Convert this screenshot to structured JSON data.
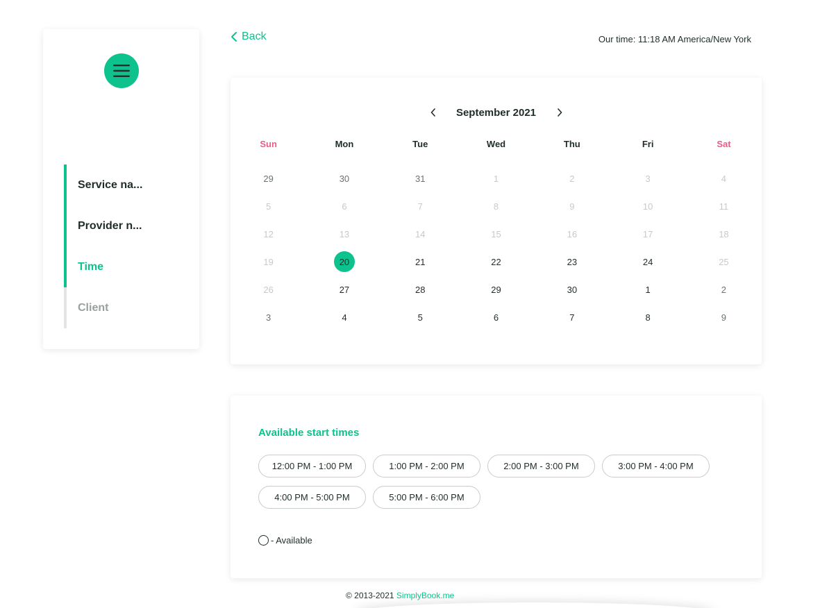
{
  "sidebar": {
    "menu_icon": "hamburger-menu-icon",
    "steps": [
      {
        "label": "Service na...",
        "state": "done"
      },
      {
        "label": "Provider n...",
        "state": "done"
      },
      {
        "label": "Time",
        "state": "active"
      },
      {
        "label": "Client",
        "state": "pending"
      }
    ]
  },
  "topbar": {
    "back_label": "Back",
    "our_time": "Our time: 11:18 AM America/New York"
  },
  "calendar": {
    "month_label": "September 2021",
    "weekdays": [
      "Sun",
      "Mon",
      "Tue",
      "Wed",
      "Thu",
      "Fri",
      "Sat"
    ],
    "weeks": [
      [
        {
          "d": "29",
          "s": "prev"
        },
        {
          "d": "30",
          "s": "prev"
        },
        {
          "d": "31",
          "s": "prev"
        },
        {
          "d": "1",
          "s": "disabled"
        },
        {
          "d": "2",
          "s": "disabled"
        },
        {
          "d": "3",
          "s": "disabled"
        },
        {
          "d": "4",
          "s": "disabled"
        }
      ],
      [
        {
          "d": "5",
          "s": "disabled"
        },
        {
          "d": "6",
          "s": "disabled"
        },
        {
          "d": "7",
          "s": "disabled"
        },
        {
          "d": "8",
          "s": "disabled"
        },
        {
          "d": "9",
          "s": "disabled"
        },
        {
          "d": "10",
          "s": "disabled"
        },
        {
          "d": "11",
          "s": "disabled"
        }
      ],
      [
        {
          "d": "12",
          "s": "disabled"
        },
        {
          "d": "13",
          "s": "disabled"
        },
        {
          "d": "14",
          "s": "disabled"
        },
        {
          "d": "15",
          "s": "disabled"
        },
        {
          "d": "16",
          "s": "disabled"
        },
        {
          "d": "17",
          "s": "disabled"
        },
        {
          "d": "18",
          "s": "disabled"
        }
      ],
      [
        {
          "d": "19",
          "s": "disabled"
        },
        {
          "d": "20",
          "s": "selected"
        },
        {
          "d": "21",
          "s": "avail"
        },
        {
          "d": "22",
          "s": "avail"
        },
        {
          "d": "23",
          "s": "avail"
        },
        {
          "d": "24",
          "s": "avail"
        },
        {
          "d": "25",
          "s": "disabled"
        }
      ],
      [
        {
          "d": "26",
          "s": "disabled"
        },
        {
          "d": "27",
          "s": "avail"
        },
        {
          "d": "28",
          "s": "avail"
        },
        {
          "d": "29",
          "s": "avail"
        },
        {
          "d": "30",
          "s": "avail"
        },
        {
          "d": "1",
          "s": "avail"
        },
        {
          "d": "2",
          "s": "prev"
        }
      ],
      [
        {
          "d": "3",
          "s": "prev"
        },
        {
          "d": "4",
          "s": "avail"
        },
        {
          "d": "5",
          "s": "avail"
        },
        {
          "d": "6",
          "s": "avail"
        },
        {
          "d": "7",
          "s": "avail"
        },
        {
          "d": "8",
          "s": "avail"
        },
        {
          "d": "9",
          "s": "prev"
        }
      ]
    ]
  },
  "times": {
    "title": "Available start times",
    "slots": [
      "12:00 PM - 1:00 PM",
      "1:00 PM - 2:00 PM",
      "2:00 PM - 3:00 PM",
      "3:00 PM - 4:00 PM",
      "4:00 PM - 5:00 PM",
      "5:00 PM - 6:00 PM"
    ],
    "legend_label": "- Available"
  },
  "footer": {
    "copyright": "© 2013-2021 ",
    "brand_link": "SimplyBook.me"
  },
  "colors": {
    "accent": "#0dc28c",
    "weekend": "#e95d86",
    "text": "#1f2d2a",
    "muted": "#c6caca"
  }
}
